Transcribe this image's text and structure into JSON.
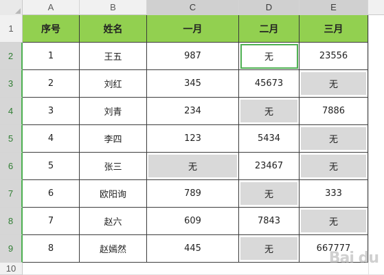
{
  "columns": [
    "A",
    "B",
    "C",
    "D",
    "E"
  ],
  "rows": [
    "1",
    "2",
    "3",
    "4",
    "5",
    "6",
    "7",
    "8",
    "9",
    "10"
  ],
  "selected_column": "C",
  "table": {
    "headers": [
      "序号",
      "姓名",
      "一月",
      "二月",
      "三月"
    ],
    "data": [
      [
        "1",
        "王五",
        "987",
        "无",
        "23556"
      ],
      [
        "2",
        "刘红",
        "345",
        "45673",
        "无"
      ],
      [
        "3",
        "刘青",
        "234",
        "无",
        "7886"
      ],
      [
        "4",
        "李四",
        "123",
        "5434",
        "无"
      ],
      [
        "5",
        "张三",
        "无",
        "23467",
        "无"
      ],
      [
        "6",
        "欧阳询",
        "789",
        "无",
        "333"
      ],
      [
        "7",
        "赵六",
        "609",
        "7843",
        "无"
      ],
      [
        "8",
        "赵嫣然",
        "445",
        "无",
        "667777"
      ]
    ]
  },
  "active_cell": "D2",
  "colors": {
    "header_fill": "#92d050",
    "empty_fill": "#d9d9d9",
    "selection": "#4caf50"
  },
  "watermark": "Bai du"
}
